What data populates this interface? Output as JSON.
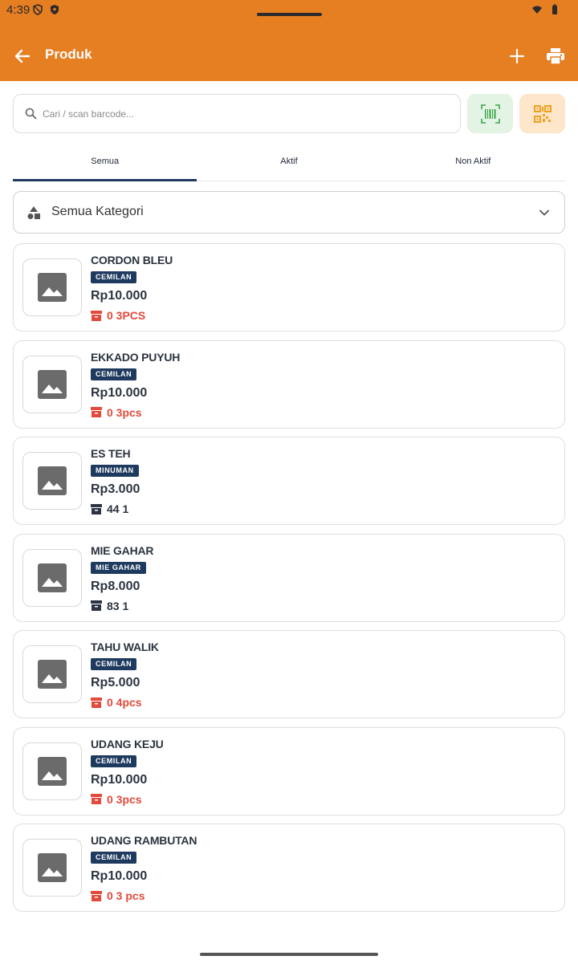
{
  "status_bar": {
    "time": "4:39"
  },
  "app_bar": {
    "title": "Produk"
  },
  "search": {
    "placeholder": "Cari / scan barcode..."
  },
  "tabs": [
    {
      "label": "Semua",
      "active": true
    },
    {
      "label": "Aktif",
      "active": false
    },
    {
      "label": "Non Aktif",
      "active": false
    }
  ],
  "category_filter": {
    "label": "Semua Kategori"
  },
  "products": [
    {
      "name": "CORDON BLEU",
      "category": "CEMILAN",
      "price": "Rp10.000",
      "stock": "0 3PCS",
      "low_stock": true
    },
    {
      "name": "EKKADO PUYUH",
      "category": "CEMILAN",
      "price": "Rp10.000",
      "stock": "0 3pcs",
      "low_stock": true
    },
    {
      "name": "ES TEH",
      "category": "MINUMAN",
      "price": "Rp3.000",
      "stock": "44 1",
      "low_stock": false
    },
    {
      "name": "MIE GAHAR",
      "category": "MIE GAHAR",
      "price": "Rp8.000",
      "stock": "83 1",
      "low_stock": false
    },
    {
      "name": "TAHU WALIK",
      "category": "CEMILAN",
      "price": "Rp5.000",
      "stock": "0 4pcs",
      "low_stock": true
    },
    {
      "name": "UDANG KEJU",
      "category": "CEMILAN",
      "price": "Rp10.000",
      "stock": "0 3pcs",
      "low_stock": true
    },
    {
      "name": "UDANG RAMBUTAN",
      "category": "CEMILAN",
      "price": "Rp10.000",
      "stock": "0 3 pcs",
      "low_stock": true
    }
  ],
  "colors": {
    "app_bar": "#E67E22",
    "badge": "#1f3a5f",
    "low_stock": "#e24a3b",
    "barcode_button_bg": "#e3f3e4",
    "qr_button_bg": "#fde6c9"
  },
  "icons": {
    "back": "arrow-left-icon",
    "add": "plus-icon",
    "print": "printer-icon",
    "search": "search-icon",
    "barcode": "barcode-icon",
    "qr": "qr-code-icon",
    "category": "shapes-icon",
    "dropdown": "chevron-down-icon",
    "thumbnail": "image-placeholder-icon",
    "stock": "archive-box-icon"
  }
}
